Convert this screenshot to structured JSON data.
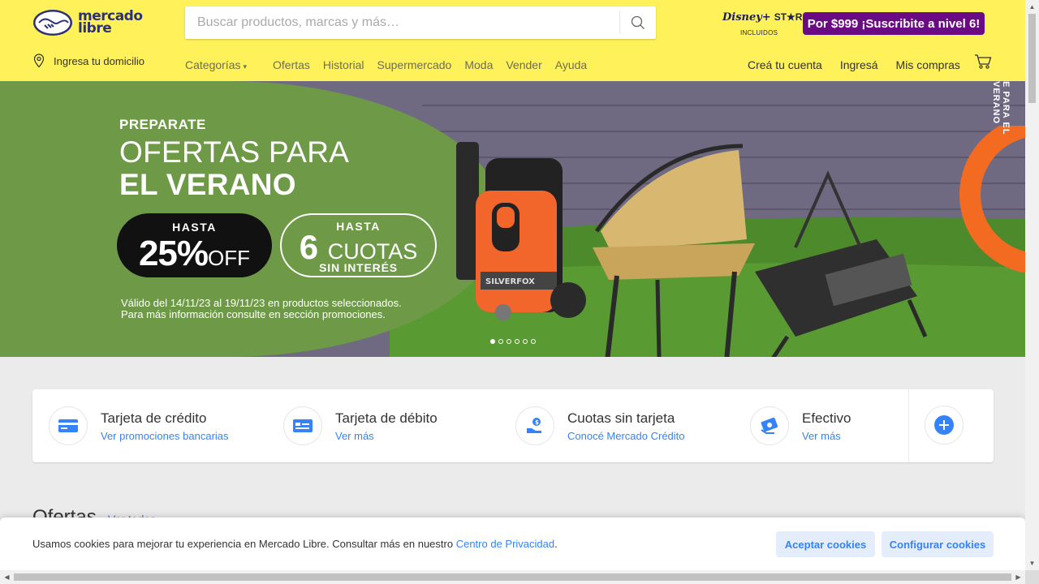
{
  "brand": {
    "logo_line1": "mercado",
    "logo_line2": "libre",
    "brand_color": "#fff159"
  },
  "search": {
    "placeholder": "Buscar productos, marcas y más…",
    "value": ""
  },
  "subscription": {
    "disney_label": "Disney+",
    "star_label": "ST★R+",
    "included_label": "INCLUIDOS",
    "promo": "Por $999 ¡Suscribite a nivel 6!",
    "promo_color": "#6b0b83"
  },
  "location": {
    "label": "Ingresa tu domicilio",
    "icon": "location-pin-icon"
  },
  "nav": {
    "items": [
      {
        "label": "Categorías",
        "has_dropdown": true
      },
      {
        "label": "Ofertas"
      },
      {
        "label": "Historial"
      },
      {
        "label": "Supermercado"
      },
      {
        "label": "Moda"
      },
      {
        "label": "Vender"
      },
      {
        "label": "Ayuda"
      }
    ],
    "user": [
      {
        "label": "Creá tu cuenta"
      },
      {
        "label": "Ingresá"
      },
      {
        "label": "Mis compras"
      }
    ],
    "cart_icon": "cart-icon"
  },
  "hero": {
    "kicker": "PREPARATE",
    "title_line1": "OFERTAS PARA",
    "title_line2": "EL VERANO",
    "discount_top": "HASTA",
    "discount_value": "25%",
    "discount_suffix": "OFF",
    "installments_top": "HASTA",
    "installments_value": "6",
    "installments_suffix": "CUOTAS",
    "installments_bottom": "SIN INTERÉS",
    "legal_line1": "Válido del 14/11/23 al 19/11/23 en productos seleccionados.",
    "legal_line2": "Para más información consulte en sección promociones.",
    "badge_text": "E PARA EL VERANO",
    "carousel_count": 6,
    "carousel_active": 0,
    "product_brand": "SILVERFOX",
    "green_color": "#6e9a47",
    "orange_color": "#f26b21"
  },
  "payments": [
    {
      "title": "Tarjeta de crédito",
      "link": "Ver promociones bancarias",
      "icon": "credit-card-icon"
    },
    {
      "title": "Tarjeta de débito",
      "link": "Ver más",
      "icon": "debit-card-icon"
    },
    {
      "title": "Cuotas sin tarjeta",
      "link": "Conocé Mercado Crédito",
      "icon": "installments-icon"
    },
    {
      "title": "Efectivo",
      "link": "Ver más",
      "icon": "cash-icon"
    }
  ],
  "payments_more_icon": "plus-icon",
  "offers": {
    "title": "Ofertas",
    "link": "Ver todas"
  },
  "cookies": {
    "text": "Usamos cookies para mejorar tu experiencia en Mercado Libre. Consultar más en nuestro ",
    "link": "Centro de Privacidad",
    "accept": "Aceptar cookies",
    "configure": "Configurar cookies",
    "link_color": "#3483fa"
  }
}
